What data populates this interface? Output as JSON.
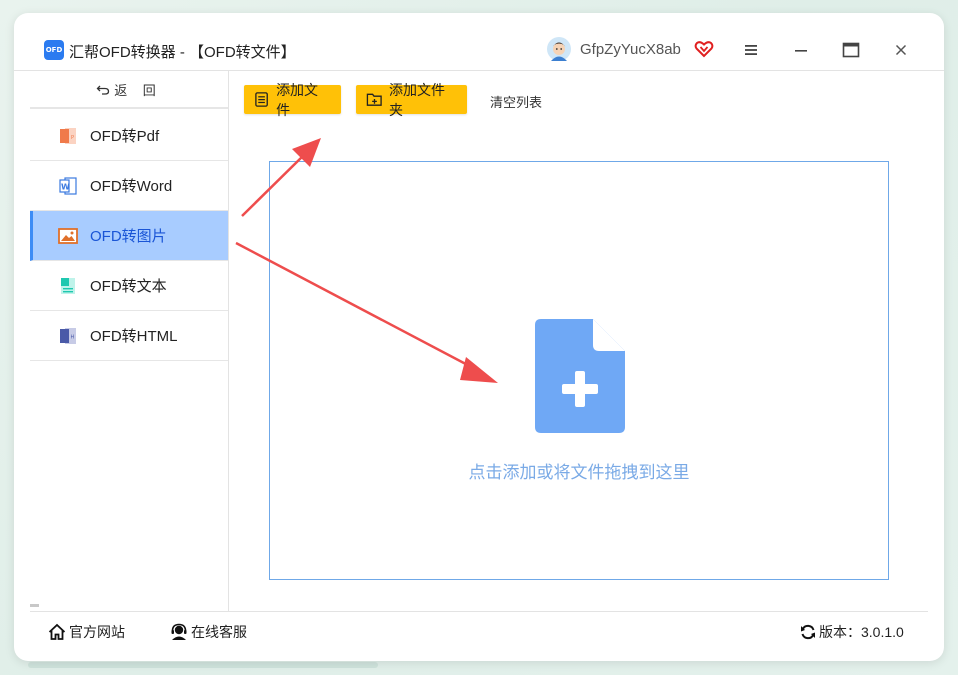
{
  "window": {
    "logo_text": "OFD",
    "title": "汇帮OFD转换器 - 【OFD转文件】",
    "username": "GfpZyYucX8ab"
  },
  "sidebar": {
    "back_label": "返 回",
    "items": [
      {
        "label": "OFD转Pdf",
        "icon": "pdf-file-icon",
        "color": "#f07a4a"
      },
      {
        "label": "OFD转Word",
        "icon": "word-file-icon",
        "color": "#3b7ae0"
      },
      {
        "label": "OFD转图片",
        "icon": "image-icon",
        "color": "#e0702a",
        "active": true
      },
      {
        "label": "OFD转文本",
        "icon": "text-file-icon",
        "color": "#1fc8b0"
      },
      {
        "label": "OFD转HTML",
        "icon": "html-file-icon",
        "color": "#4a5aa8"
      }
    ]
  },
  "toolbar": {
    "add_file": "添加文件",
    "add_folder": "添加文件夹",
    "clear_list": "清空列表"
  },
  "dropzone": {
    "hint": "点击添加或将文件拖拽到这里"
  },
  "footer": {
    "official_site": "官方网站",
    "online_service": "在线客服",
    "version": "版本：3.0.1.0"
  },
  "colors": {
    "accent_yellow": "#ffc107",
    "active_bg": "#a8ccff",
    "active_text": "#1a55d6",
    "drop_icon": "#6fa8f5",
    "arrow_red": "#ee4d4d"
  }
}
